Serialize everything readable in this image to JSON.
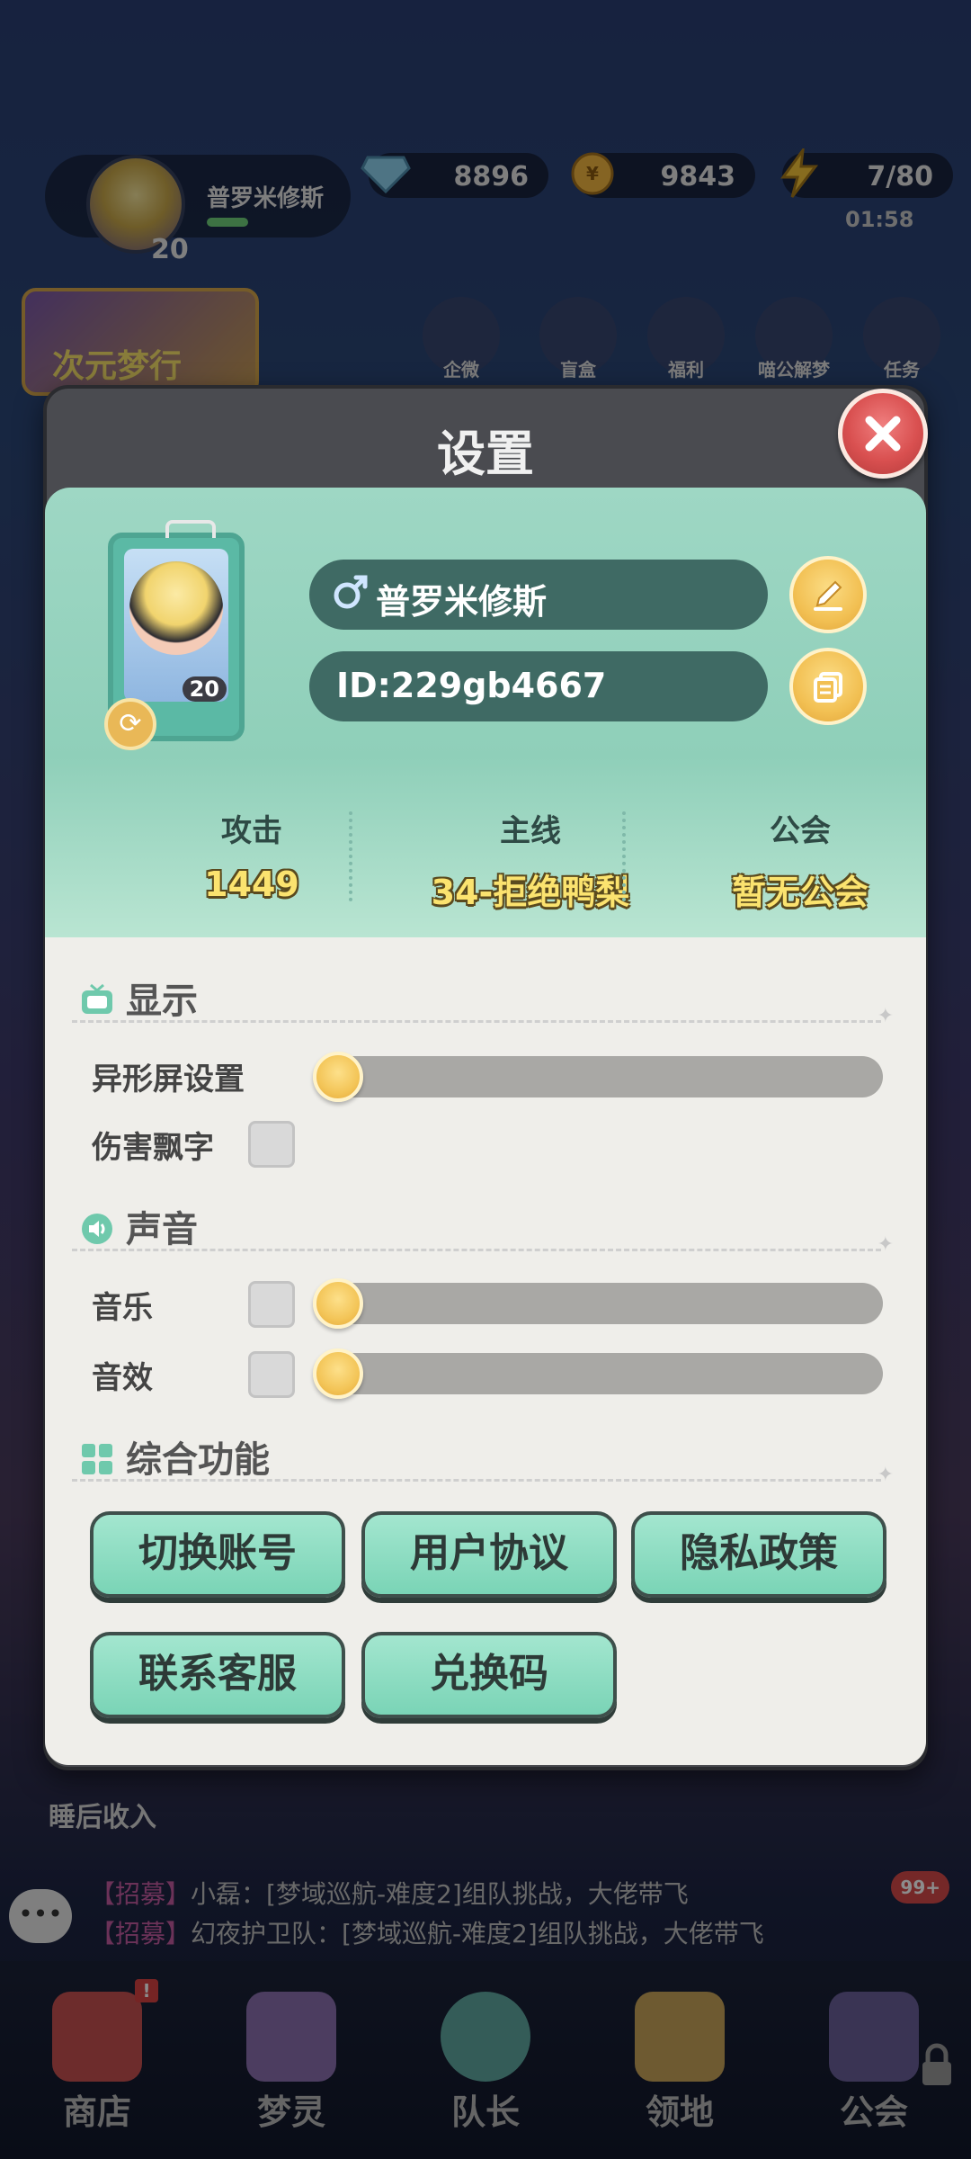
{
  "hud": {
    "player_name": "普罗米修斯",
    "player_level": "20",
    "gems": "8896",
    "coins": "9843",
    "energy": "7/80",
    "energy_timer": "01:58",
    "event_banner": "次元梦行",
    "menu_items": [
      "企微",
      "盲盒",
      "福利",
      "喵公解梦",
      "任务"
    ]
  },
  "modal": {
    "title": "设置",
    "profile": {
      "gender_icon": "male-icon",
      "name": "普罗米修斯",
      "id": "ID:229gb4667",
      "avatar_level": "20"
    },
    "stats": [
      {
        "label": "攻击",
        "value": "1449"
      },
      {
        "label": "主线",
        "value": "34-拒绝鸭梨"
      },
      {
        "label": "公会",
        "value": "暂无公会"
      }
    ],
    "display": {
      "title": "显示",
      "notch_label": "异形屏设置",
      "notch_value": 0,
      "damage_text_label": "伤害飘字",
      "damage_text_checked": false
    },
    "sound": {
      "title": "声音",
      "music_label": "音乐",
      "music_value": 0,
      "music_muted": false,
      "sfx_label": "音效",
      "sfx_value": 0,
      "sfx_muted": false
    },
    "functions": {
      "title": "综合功能",
      "buttons": [
        "切换账号",
        "用户协议",
        "隐私政策",
        "联系客服",
        "兑换码"
      ]
    }
  },
  "footer": {
    "sleep_income": "睡后收入",
    "chat": [
      {
        "tag": "【招募】",
        "text": "小磊：[梦域巡航-难度2]组队挑战，大佬带飞"
      },
      {
        "tag": "【招募】",
        "text": "幻夜护卫队：[梦域巡航-难度2]组队挑战，大佬带飞"
      }
    ],
    "chat_badge": "99+",
    "nav": [
      "商店",
      "梦灵",
      "队长",
      "领地",
      "公会"
    ]
  },
  "colors": {
    "accent_mint": "#8fcfb9",
    "gold": "#f3c558",
    "close_red": "#d95050",
    "panel": "#efeeea"
  }
}
